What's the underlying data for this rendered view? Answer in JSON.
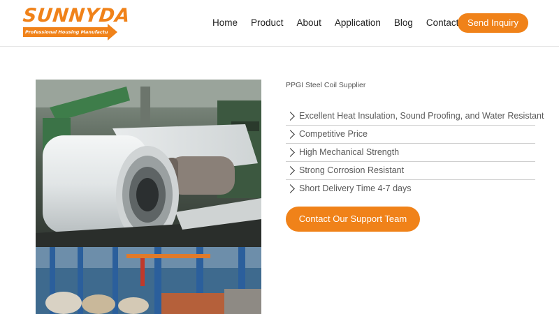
{
  "header": {
    "logo": {
      "name": "SUNNYDA",
      "tagline": "Professional Housing Manufacturer"
    },
    "nav": [
      "Home",
      "Product",
      "About",
      "Application",
      "Blog",
      "Contact"
    ],
    "cta_label": "Send Inquiry"
  },
  "main": {
    "subtitle": "PPGI Steel Coil Supplier",
    "features": [
      "Excellent Heat Insulation, Sound Proofing, and Water Resistant",
      "Competitive Price",
      "High Mechanical Strength",
      "Strong Corrosion Resistant",
      "Short Delivery Time 4-7 days"
    ],
    "support_button": "Contact Our Support Team"
  },
  "colors": {
    "accent": "#f08219",
    "text": "#1f1f1f",
    "muted": "#5a5a5a",
    "divider": "#cfcfcf"
  },
  "icons": {
    "feature_bullet": "chevron-right-icon"
  }
}
